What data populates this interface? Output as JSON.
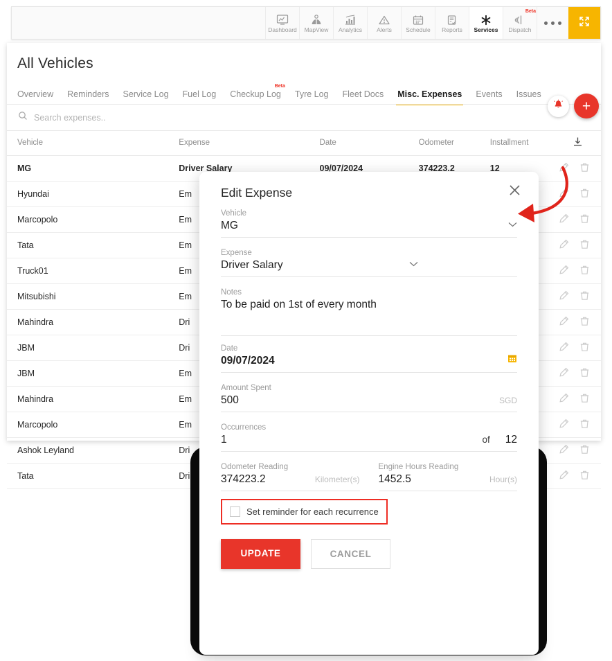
{
  "topnav": {
    "items": [
      {
        "label": "Dashboard",
        "icon": "monitor-chart-icon",
        "active": false,
        "beta": ""
      },
      {
        "label": "MapView",
        "icon": "map-pin-icon",
        "active": false,
        "beta": ""
      },
      {
        "label": "Analytics",
        "icon": "bar-chart-icon",
        "active": false,
        "beta": ""
      },
      {
        "label": "Alerts",
        "icon": "warning-triangle-icon",
        "active": false,
        "beta": ""
      },
      {
        "label": "Schedule",
        "icon": "calendar-icon",
        "active": false,
        "beta": ""
      },
      {
        "label": "Reports",
        "icon": "clipboard-check-icon",
        "active": false,
        "beta": ""
      },
      {
        "label": "Services",
        "icon": "asterisk-tool-icon",
        "active": true,
        "beta": ""
      },
      {
        "label": "Dispatch",
        "icon": "signal-icon",
        "active": false,
        "beta": "Beta"
      }
    ],
    "more_label": "more-options",
    "expand_label": "expand-icon",
    "accent_yellow": "#f7b500"
  },
  "page": {
    "title": "All Vehicles",
    "tabs": [
      {
        "label": "Overview",
        "active": false,
        "beta": ""
      },
      {
        "label": "Reminders",
        "active": false,
        "beta": ""
      },
      {
        "label": "Service Log",
        "active": false,
        "beta": ""
      },
      {
        "label": "Fuel Log",
        "active": false,
        "beta": ""
      },
      {
        "label": "Checkup Log",
        "active": false,
        "beta": "Beta"
      },
      {
        "label": "Tyre Log",
        "active": false,
        "beta": ""
      },
      {
        "label": "Fleet Docs",
        "active": false,
        "beta": ""
      },
      {
        "label": "Misc. Expenses",
        "active": true,
        "beta": ""
      },
      {
        "label": "Events",
        "active": false,
        "beta": ""
      },
      {
        "label": "Issues",
        "active": false,
        "beta": ""
      }
    ],
    "bell_icon": "notification-bell-icon",
    "add_icon": "add-plus-icon",
    "accent_red": "#e8352a"
  },
  "search": {
    "placeholder": "Search expenses..",
    "value": "",
    "icon": "search-icon"
  },
  "table": {
    "columns": [
      "Vehicle",
      "Expense",
      "Date",
      "Odometer",
      "Installment"
    ],
    "download_icon": "download-icon",
    "edit_icon": "pencil-edit-icon",
    "delete_icon": "trash-delete-icon",
    "rows": [
      {
        "vehicle": "MG",
        "expense": "Driver Salary",
        "date": "09/07/2024",
        "odometer": "374223.2",
        "installment": "12"
      },
      {
        "vehicle": "Hyundai",
        "expense": "Em",
        "date": "",
        "odometer": "",
        "installment": ""
      },
      {
        "vehicle": "Marcopolo",
        "expense": "Em",
        "date": "",
        "odometer": "",
        "installment": ""
      },
      {
        "vehicle": "Tata",
        "expense": "Em",
        "date": "",
        "odometer": "",
        "installment": ""
      },
      {
        "vehicle": "Truck01",
        "expense": "Em",
        "date": "",
        "odometer": "",
        "installment": ""
      },
      {
        "vehicle": "Mitsubishi",
        "expense": "Em",
        "date": "",
        "odometer": "",
        "installment": ""
      },
      {
        "vehicle": "Mahindra",
        "expense": "Dri",
        "date": "",
        "odometer": "",
        "installment": ""
      },
      {
        "vehicle": "JBM",
        "expense": "Dri",
        "date": "",
        "odometer": "",
        "installment": ""
      },
      {
        "vehicle": "JBM",
        "expense": "Em",
        "date": "",
        "odometer": "",
        "installment": ""
      },
      {
        "vehicle": "Mahindra",
        "expense": "Em",
        "date": "",
        "odometer": "",
        "installment": ""
      },
      {
        "vehicle": "Marcopolo",
        "expense": "Em",
        "date": "",
        "odometer": "",
        "installment": ""
      },
      {
        "vehicle": "Ashok Leyland",
        "expense": "Dri",
        "date": "",
        "odometer": "",
        "installment": ""
      },
      {
        "vehicle": "Tata",
        "expense": "Dri",
        "date": "",
        "odometer": "",
        "installment": ""
      }
    ]
  },
  "modal": {
    "title": "Edit Expense",
    "close_icon": "close-icon",
    "vehicle": {
      "label": "Vehicle",
      "value": "MG",
      "caret": "chevron-down-icon"
    },
    "expense": {
      "label": "Expense",
      "value": "Driver Salary",
      "caret": "chevron-down-icon"
    },
    "notes": {
      "label": "Notes",
      "value": "To be paid on 1st of every month"
    },
    "date": {
      "label": "Date",
      "value": "09/07/2024",
      "icon": "calendar-icon"
    },
    "amount": {
      "label": "Amount Spent",
      "value": "500",
      "currency": "SGD"
    },
    "occurrences": {
      "label": "Occurrences",
      "value": "1",
      "of": "of",
      "total": "12"
    },
    "odometer": {
      "label": "Odometer Reading",
      "value": "374223.2",
      "unit": "Kilometer(s)"
    },
    "engine_hours": {
      "label": "Engine Hours Reading",
      "value": "1452.5",
      "unit": "Hour(s)"
    },
    "reminder": {
      "label": "Set reminder for each recurrence",
      "checked": false,
      "highlight_color": "#ee2d24"
    },
    "update_label": "UPDATE",
    "cancel_label": "CANCEL"
  }
}
